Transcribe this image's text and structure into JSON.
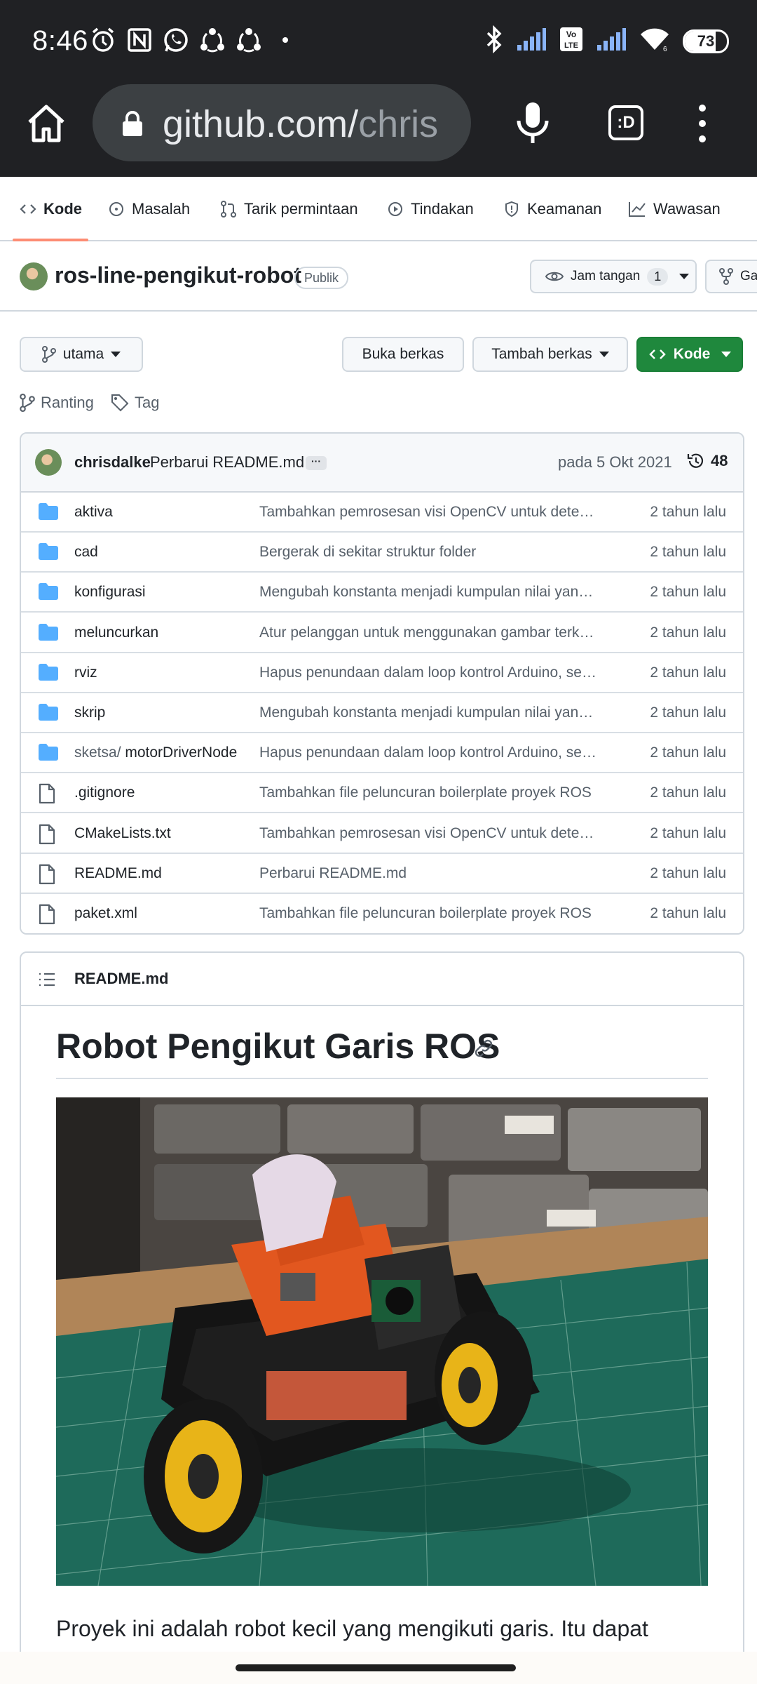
{
  "status_bar": {
    "time": "8:46",
    "battery_percent": "73",
    "battery_level": 0.73,
    "left_icons": [
      "alarm-icon",
      "nfc-icon",
      "whatsapp-icon",
      "sync-icon",
      "sync-icon",
      "dot-icon"
    ],
    "right_icons": [
      "bluetooth-icon",
      "signal-icon",
      "volte-icon",
      "signal-icon",
      "wifi-icon",
      "battery-icon"
    ]
  },
  "browser": {
    "url_host": "github.com/",
    "url_path": "chris",
    "tabs_label": ":D"
  },
  "repo_nav": {
    "items": [
      {
        "label": "Kode",
        "icon": "code-icon",
        "active": true
      },
      {
        "label": "Masalah",
        "icon": "issue-icon"
      },
      {
        "label": "Tarik permintaan",
        "icon": "pull-request-icon"
      },
      {
        "label": "Tindakan",
        "icon": "play-icon"
      },
      {
        "label": "Keamanan",
        "icon": "shield-icon"
      },
      {
        "label": "Wawasan",
        "icon": "graph-icon"
      }
    ]
  },
  "repo": {
    "name": "ros-line-pengikut-robot",
    "visibility": "Publik",
    "watch_label": "Jam tangan",
    "watch_count": "1",
    "next_button_label": "Ga"
  },
  "controls": {
    "branch": "utama",
    "open_file": "Buka berkas",
    "add_file": "Tambah berkas",
    "code": "Kode",
    "branches_label": "Ranting",
    "tags_label": "Tag"
  },
  "commit": {
    "author": "chrisdalke",
    "message": "Perbarui README.md",
    "dots": "···",
    "date": "pada 5 Okt 2021",
    "count": "48"
  },
  "files": [
    {
      "type": "folder",
      "name": "aktiva",
      "prefix": "",
      "commit": "Tambahkan pemrosesan visi OpenCV untuk deteksi garis",
      "age": "2 tahun lalu"
    },
    {
      "type": "folder",
      "name": "cad",
      "prefix": "",
      "commit": "Bergerak di sekitar struktur folder",
      "age": "2 tahun lalu"
    },
    {
      "type": "folder",
      "name": "konfigurasi",
      "prefix": "",
      "commit": "Mengubah konstanta menjadi kumpulan nilai yang dapat dikonfigurasi",
      "age": "2 tahun lalu"
    },
    {
      "type": "folder",
      "name": "meluncurkan",
      "prefix": "",
      "commit": "Atur pelanggan untuk menggunakan gambar terkompresi",
      "age": "2 tahun lalu"
    },
    {
      "type": "folder",
      "name": "rviz",
      "prefix": "",
      "commit": "Hapus penundaan dalam loop kontrol Arduino, sederhanakan",
      "age": "2 tahun lalu"
    },
    {
      "type": "folder",
      "name": "skrip",
      "prefix": "",
      "commit": "Mengubah konstanta menjadi kumpulan nilai yang dapat dikonfigurasi",
      "age": "2 tahun lalu"
    },
    {
      "type": "folder",
      "name": "motorDriverNode",
      "prefix": "sketsa/ ",
      "commit": "Hapus penundaan dalam loop kontrol Arduino, sederhanakan",
      "age": "2 tahun lalu"
    },
    {
      "type": "file",
      "name": ".gitignore",
      "prefix": "",
      "commit": "Tambahkan file peluncuran boilerplate proyek ROS",
      "age": "2 tahun lalu"
    },
    {
      "type": "file",
      "name": "CMakeLists.txt",
      "prefix": "",
      "commit": "Tambahkan pemrosesan visi OpenCV untuk deteksi garis",
      "age": "2 tahun lalu"
    },
    {
      "type": "file",
      "name": "README.md",
      "prefix": "",
      "commit": "Perbarui README.md",
      "age": "2 tahun lalu"
    },
    {
      "type": "file",
      "name": "paket.xml",
      "prefix": "",
      "commit": "Tambahkan file peluncuran boilerplate proyek ROS",
      "age": "2 tahun lalu"
    }
  ],
  "readme": {
    "filename": "README.md",
    "heading": "Robot Pengikut Garis ROS",
    "paragraph": "Proyek ini adalah robot kecil yang mengikuti garis. Itu dapat"
  },
  "colors": {
    "accent_green": "#1f883d",
    "tab_underline": "#fd8c73",
    "folder_blue": "#54aeff",
    "status_bg": "#202124"
  }
}
